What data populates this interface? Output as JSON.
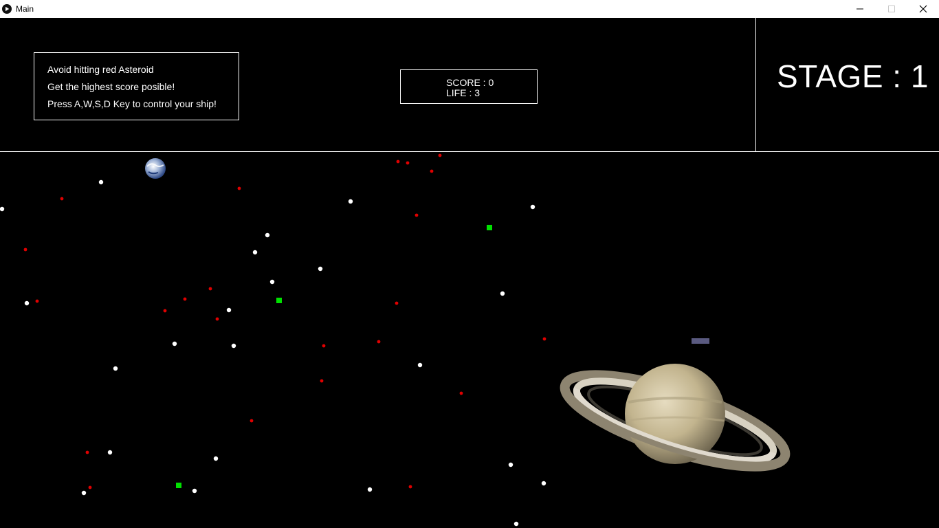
{
  "window": {
    "title": "Main",
    "icons": {
      "app": "play-circle-icon",
      "minimize": "minimize-icon",
      "maximize": "maximize-icon",
      "close": "close-icon"
    }
  },
  "hud": {
    "instructions": [
      "Avoid hitting red Asteroid",
      "Get the highest score posible!",
      "Press A,W,S,D Key to control your ship!"
    ],
    "score_text": "SCORE : 0",
    "life_text": "LIFE : 3",
    "stage_text": "STAGE : 1"
  },
  "game": {
    "score": 0,
    "life": 3,
    "stage": 1,
    "colors": {
      "background": "#000000",
      "star": "#ffffff",
      "asteroid": "#e00000",
      "bonus": "#00e000",
      "ship": "#5a5a80"
    }
  }
}
